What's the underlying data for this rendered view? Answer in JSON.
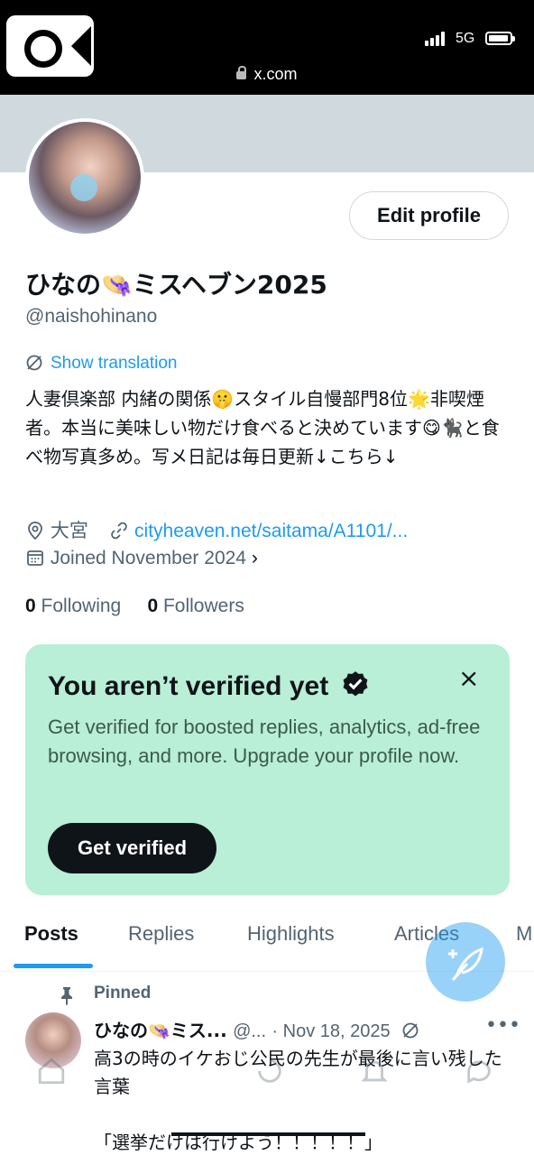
{
  "status_bar": {
    "network": "5G",
    "url": "x.com"
  },
  "profile": {
    "display_name": "ひなの👒ミスヘブン2025",
    "handle": "@naishohinano",
    "edit_button": "Edit profile",
    "show_translation": "Show translation",
    "bio": "人妻倶楽部 内緒の関係🤫スタイル自慢部門8位🌟非喫煙者。本当に美味しい物だけ食べると決めています😋🐈‍⬛と食べ物写真多め。写メ日記は毎日更新↓こちら↓",
    "location": "大宮",
    "website": "cityheaven.net/saitama/A1101/...",
    "joined": "Joined November 2024",
    "following_count": "0",
    "following_label": "Following",
    "followers_count": "0",
    "followers_label": "Followers"
  },
  "verify_card": {
    "title": "You aren’t verified yet",
    "description": "Get verified for boosted replies, analytics, ad-free browsing, and more. Upgrade your profile now.",
    "button": "Get verified",
    "close_icon": "×"
  },
  "tabs": [
    {
      "label": "Posts",
      "active": true
    },
    {
      "label": "Replies",
      "active": false
    },
    {
      "label": "Highlights",
      "active": false
    },
    {
      "label": "Articles",
      "active": false
    },
    {
      "label": "M",
      "active": false
    }
  ],
  "post": {
    "pinned_label": "Pinned",
    "author": "ひなの👒ミス...",
    "handle": "@...",
    "date": "· Nov 18, 2025",
    "text": "高3の時のイケおじ公民の先生が最後に言い残した言葉",
    "quote": "「選挙だけは行けよう！！！！！」"
  },
  "icons": {
    "location": "location-pin-icon",
    "link": "link-icon",
    "calendar": "calendar-icon",
    "verified": "verified-badge-icon",
    "compose": "compose-post-icon",
    "pin": "pin-icon"
  },
  "colors": {
    "accent": "#1d9bf0",
    "card_bg": "#b8efd6",
    "banner": "#cfd9de",
    "text": "#0f1419",
    "secondary": "#536471"
  }
}
